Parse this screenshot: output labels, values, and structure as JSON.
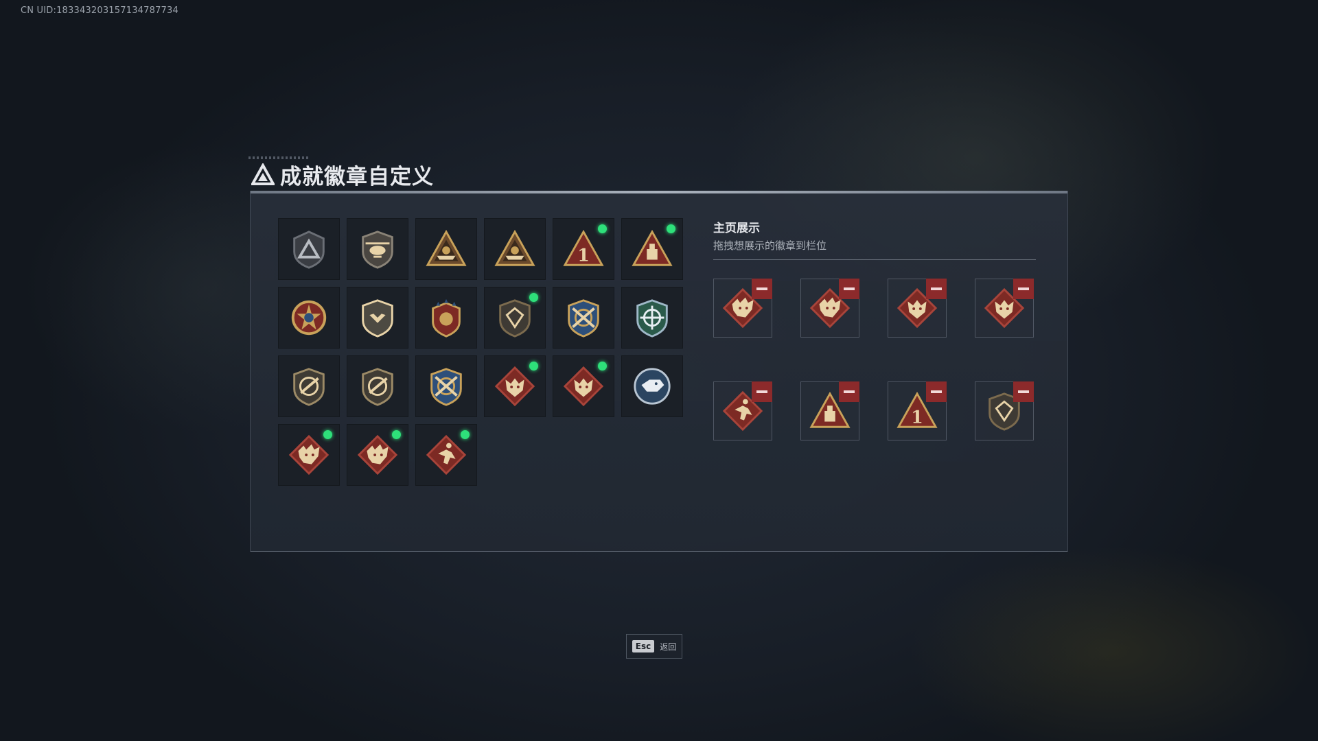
{
  "uid_text": "CN UID:18334320315713478773​4",
  "title": "成就徽章自定义",
  "showcase": {
    "title": "主页展示",
    "subtitle": "拖拽想展示的徽章到栏位"
  },
  "badges": [
    {
      "icon": "triangle-shield-gray-badge",
      "new": false
    },
    {
      "icon": "helicopter-shield-badge",
      "new": false
    },
    {
      "icon": "boat-triangle-badge",
      "new": false
    },
    {
      "icon": "tank-triangle-badge",
      "new": false
    },
    {
      "icon": "number-one-red-triangle-badge",
      "new": true
    },
    {
      "icon": "crate-red-triangle-badge",
      "new": true
    },
    {
      "icon": "star-medal-badge",
      "new": false
    },
    {
      "icon": "wing-shield-badge",
      "new": false
    },
    {
      "icon": "star-crest-badge",
      "new": false
    },
    {
      "icon": "gem-shield-badge",
      "new": true
    },
    {
      "icon": "crossed-guns-shield-badge",
      "new": false
    },
    {
      "icon": "blue-crosshair-badge",
      "new": false
    },
    {
      "icon": "rifle-shield-badge",
      "new": false
    },
    {
      "icon": "rifle-shield-badge-2",
      "new": false
    },
    {
      "icon": "crossed-guns-crest-badge",
      "new": false
    },
    {
      "icon": "red-wolf-diamond-badge",
      "new": true
    },
    {
      "icon": "red-wolf-diamond-badge-2",
      "new": true
    },
    {
      "icon": "blue-wolf-round-badge",
      "new": false
    },
    {
      "icon": "red-dragon-diamond-badge",
      "new": true
    },
    {
      "icon": "red-dragon-diamond-badge-2",
      "new": true
    },
    {
      "icon": "runner-diamond-badge",
      "new": true
    }
  ],
  "slots": [
    {
      "icon": "red-dragon-diamond-badge"
    },
    {
      "icon": "red-dragon-diamond-badge"
    },
    {
      "icon": "red-wolf-diamond-badge"
    },
    {
      "icon": "red-wolf-diamond-badge"
    },
    {
      "icon": "runner-diamond-badge"
    },
    {
      "icon": "crate-red-triangle-badge"
    },
    {
      "icon": "number-one-red-triangle-badge"
    },
    {
      "icon": "gem-shield-badge"
    }
  ],
  "esc": {
    "key": "Esc",
    "label": "返回"
  }
}
